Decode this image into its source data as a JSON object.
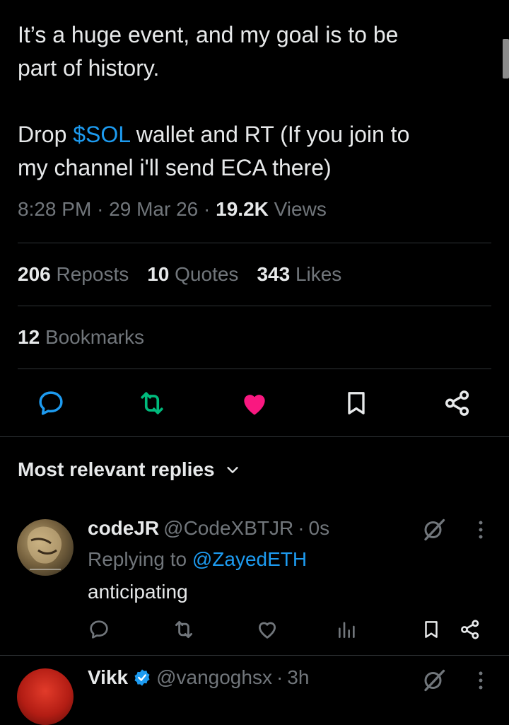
{
  "tweet": {
    "line1": "It’s a huge event, and my goal is to be",
    "line2": "part of history.",
    "line3_prefix": "Drop ",
    "cashtag": "$SOL",
    "line3_suffix": " wallet and RT (If you join to",
    "line4": "my channel i'll send ECA there)"
  },
  "meta": {
    "time": "8:28 PM",
    "sep1": "·",
    "date": "29 Mar 26",
    "sep2": "·",
    "views_count": "19.2K",
    "views_label": "Views"
  },
  "stats": {
    "reposts_count": "206",
    "reposts_label": "Reposts",
    "quotes_count": "10",
    "quotes_label": "Quotes",
    "likes_count": "343",
    "likes_label": "Likes",
    "bookmarks_count": "12",
    "bookmarks_label": "Bookmarks"
  },
  "colors": {
    "background": "#000000",
    "text": "#e7e9ea",
    "muted": "#71767b",
    "link": "#1d9bf0",
    "repost_green": "#00ba7c",
    "like_pink": "#f91880",
    "divider": "#2f3336"
  },
  "actions": [
    "reply-icon",
    "repost-icon",
    "like-icon",
    "bookmark-icon",
    "share-icon"
  ],
  "replies_header": {
    "label": "Most relevant replies"
  },
  "replies": [
    {
      "name": "codeJR",
      "handle": "@CodeXBTJR",
      "sep": "·",
      "time": "0s",
      "replying_prefix": "Replying to ",
      "replying_to": "@ZayedETH",
      "text": "anticipating"
    },
    {
      "name": "Vikk",
      "handle": "@vangoghsx",
      "sep": "·",
      "time": "3h"
    }
  ]
}
